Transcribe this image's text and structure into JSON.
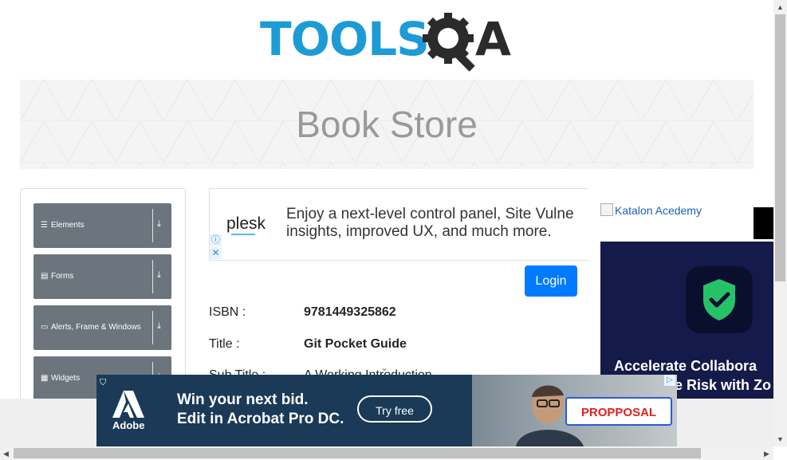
{
  "brand": {
    "logo_text_1": "TOOLS",
    "logo_text_2": "A",
    "logo_q_icon": "gear-magnifier-icon"
  },
  "banner": {
    "title": "Book Store"
  },
  "sidebar": {
    "groups": [
      {
        "label": "Elements",
        "icon": "menu-lines-icon"
      },
      {
        "label": "Forms",
        "icon": "form-icon"
      },
      {
        "label": "Alerts, Frame & Windows",
        "icon": "window-icon"
      },
      {
        "label": "Widgets",
        "icon": "grid-icon"
      }
    ]
  },
  "ad_top": {
    "brand": "plesk",
    "copy_line1": "Enjoy a next-level control panel, Site Vulne",
    "copy_line2": "insights, improved UX, and much more."
  },
  "login": {
    "label": "Login"
  },
  "book": {
    "isbn_label": "ISBN :",
    "isbn_value": "9781449325862",
    "title_label": "Title :",
    "title_value": "Git Pocket Guide",
    "subtitle_label": "Sub Title :",
    "subtitle_value": "A Working Introduction"
  },
  "right_ad": {
    "image_alt": "Katalon Acedemy",
    "headline_1": "Accelerate Collabora",
    "headline_2": "e Risk with Zo"
  },
  "bottom_ad": {
    "brand": "Adobe",
    "copy_line1": "Win your next bid.",
    "copy_line2": "Edit in Acrobat Pro DC.",
    "cta": "Try free",
    "proposal": "PROPPOSAL"
  },
  "colors": {
    "brand_blue": "#1d9bd6",
    "button_primary": "#007bff",
    "sidebar_group": "#6c757d"
  }
}
